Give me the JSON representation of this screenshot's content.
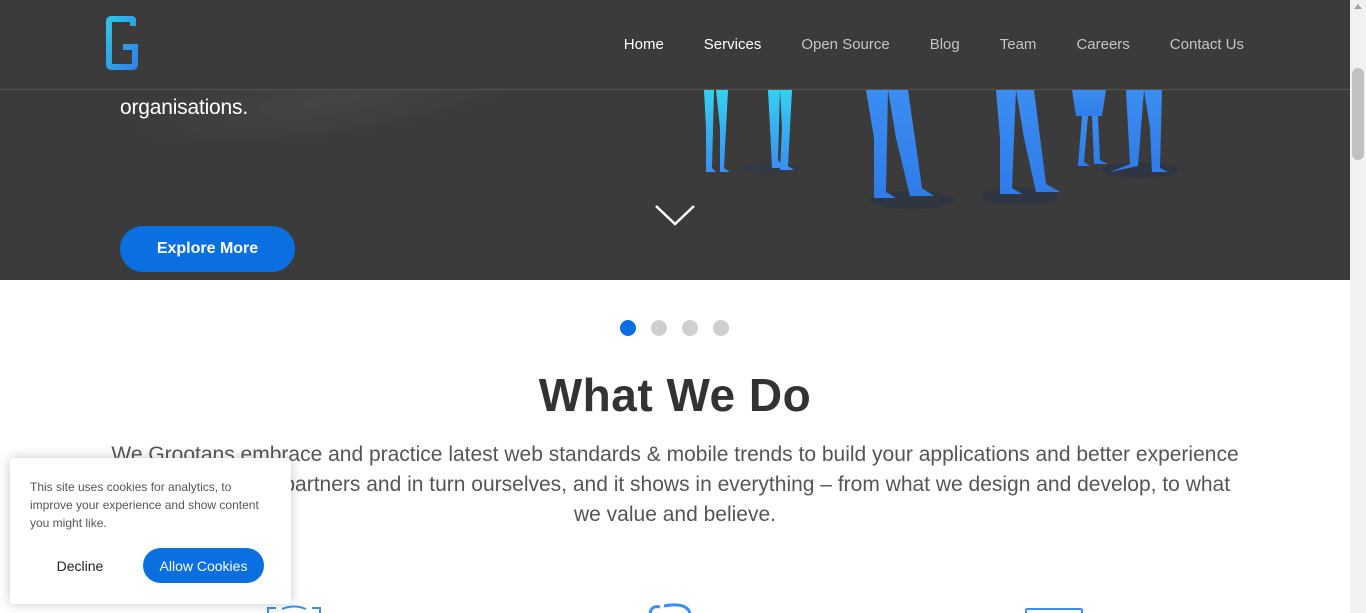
{
  "brand": {
    "logo_icon": "grootan-g-logo-icon",
    "accent": "#0a6fe0",
    "logo_gradient": [
      "#2fc6e6",
      "#2f7fe8"
    ]
  },
  "nav": {
    "items": [
      {
        "label": "Home",
        "active": true
      },
      {
        "label": "Services",
        "active": true
      },
      {
        "label": "Open Source",
        "active": false
      },
      {
        "label": "Blog",
        "active": false
      },
      {
        "label": "Team",
        "active": false
      },
      {
        "label": "Careers",
        "active": false
      },
      {
        "label": "Contact Us",
        "active": false
      }
    ]
  },
  "hero": {
    "text": "organisations.",
    "button_label": "Explore More",
    "scroll_icon": "chevron-down-icon",
    "background": "#3b3b3b"
  },
  "carousel": {
    "slides": 4,
    "active_index": 0
  },
  "what_we_do": {
    "title": "What We Do",
    "description": "We Grootans embrace and practice latest web standards & mobile trends to build your applications and better experience for our client, our partners and in turn ourselves, and it shows in everything – from what we design and develop, to what we value and believe."
  },
  "cookie_banner": {
    "message": "This site uses cookies for analytics, to improve your experience and show content you might like.",
    "decline_label": "Decline",
    "allow_label": "Allow Cookies"
  }
}
